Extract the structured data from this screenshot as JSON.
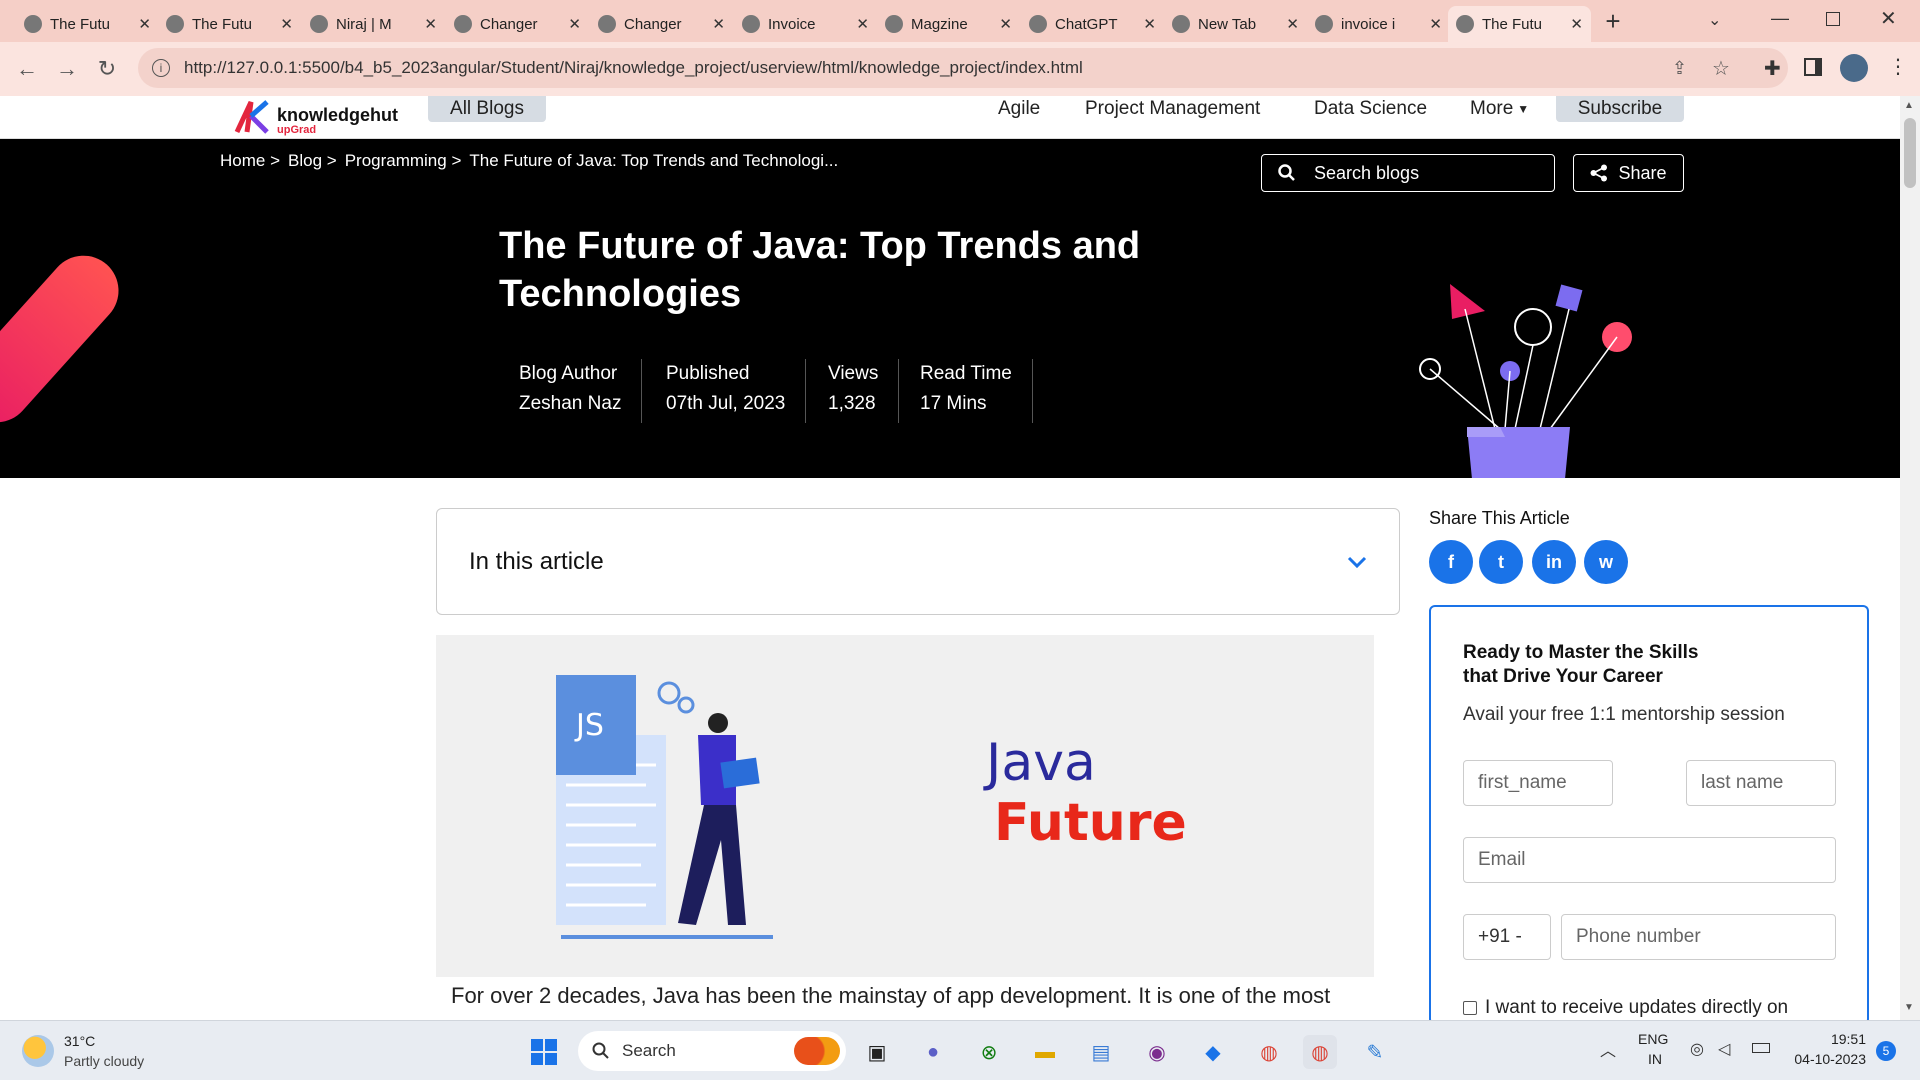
{
  "browser": {
    "tabs": [
      {
        "title": "The Futu",
        "icon": "globe-icon"
      },
      {
        "title": "The Futu",
        "icon": "globe-icon"
      },
      {
        "title": "Niraj | M",
        "icon": "avatar-icon"
      },
      {
        "title": "Changer",
        "icon": "github-icon"
      },
      {
        "title": "Changer",
        "icon": "github-icon"
      },
      {
        "title": "Invoice",
        "icon": "mail-icon"
      },
      {
        "title": "Magzine",
        "icon": "office-icon"
      },
      {
        "title": "ChatGPT",
        "icon": "chatgpt-icon"
      },
      {
        "title": "New Tab",
        "icon": "chrome-icon"
      },
      {
        "title": "invoice i",
        "icon": "google-icon"
      },
      {
        "title": "The Futu",
        "icon": "globe-icon"
      }
    ],
    "new_tab": "+",
    "url": "http://127.0.0.1:5500/b4_b5_2023angular/Student/Niraj/knowledge_project/userview/html/knowledge_project/index.html"
  },
  "site": {
    "logo_text": "knowledgehut",
    "logo_sub": "upGrad",
    "all_blogs": "All Blogs",
    "nav": [
      "Agile",
      "Project Management",
      "Data Science",
      "More"
    ],
    "subscribe": "Subscribe"
  },
  "hero": {
    "breadcrumb": [
      "Home >",
      "Blog >",
      "Programming >",
      "The Future of Java: Top Trends and Technologi..."
    ],
    "search_placeholder": "Search blogs",
    "share": "Share",
    "title_line1": "The Future of Java: Top Trends and",
    "title_line2": "Technologies",
    "meta": [
      {
        "label": "Blog Author",
        "value": "Zeshan Naz"
      },
      {
        "label": "Published",
        "value": "07th Jul, 2023"
      },
      {
        "label": "Views",
        "value": "1,328"
      },
      {
        "label": "Read Time",
        "value": "17 Mins"
      }
    ]
  },
  "article": {
    "toc_label": "In this article",
    "image_js": "JS",
    "image_word1": "Java",
    "image_word2": "Future",
    "first_para": "For over 2 decades, Java has been the mainstay of app development. It is one of the most"
  },
  "sidebar": {
    "share_label": "Share This Article",
    "share_buttons": [
      "f",
      "t",
      "in",
      "w"
    ],
    "form_title_1": "Ready to Master the Skills",
    "form_title_2": "that Drive Your Career",
    "form_sub": "Avail your free 1:1 mentorship session",
    "first_name": "first_name",
    "last_name": "last name",
    "email": "Email",
    "code": "+91 -",
    "phone": "Phone number",
    "consent": "I want to receive updates directly on"
  },
  "taskbar": {
    "weather_temp": "31°C",
    "weather_desc": "Partly cloudy",
    "search": "Search",
    "lang1": "ENG",
    "lang2": "IN",
    "time": "19:51",
    "date": "04-10-2023",
    "badge": "5"
  },
  "colors": {
    "accent": "#1a73e8",
    "hero_bg": "#000000",
    "tabbar": "#f5cfc7",
    "brand_red": "#e3263e"
  }
}
